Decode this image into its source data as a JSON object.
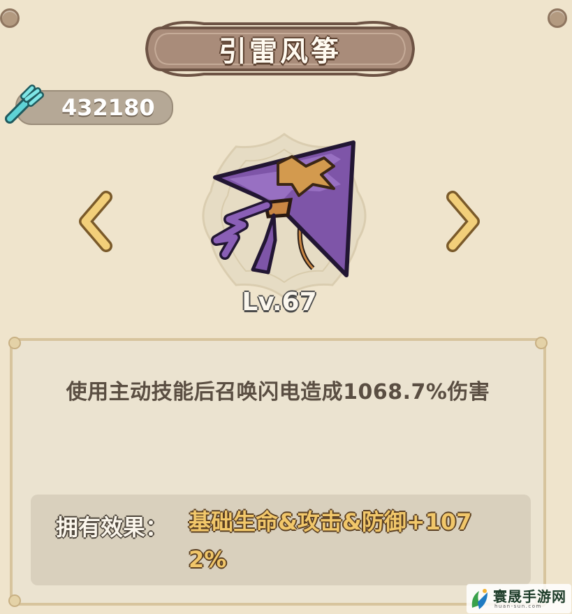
{
  "item": {
    "name": "引雷风筝",
    "level": "Lv.67",
    "icon": "kite-icon"
  },
  "currency": {
    "icon": "wrench-icon",
    "amount": "432180"
  },
  "navigation": {
    "prev_icon": "chevron-left-icon",
    "next_icon": "chevron-right-icon"
  },
  "panel": {
    "description": "使用主动技能后召唤闪电造成1068.7%伤害",
    "effect_label": "拥有效果：",
    "effect_value": "基础生命&攻击&防御+1072%"
  },
  "watermark": {
    "title": "寰晟手游网",
    "url": "huan-sun.com"
  },
  "colors": {
    "background": "#efe4cc",
    "banner": "#a98c7a",
    "effect_highlight": "#f1c76a",
    "kite_purple": "#7e55a8"
  }
}
